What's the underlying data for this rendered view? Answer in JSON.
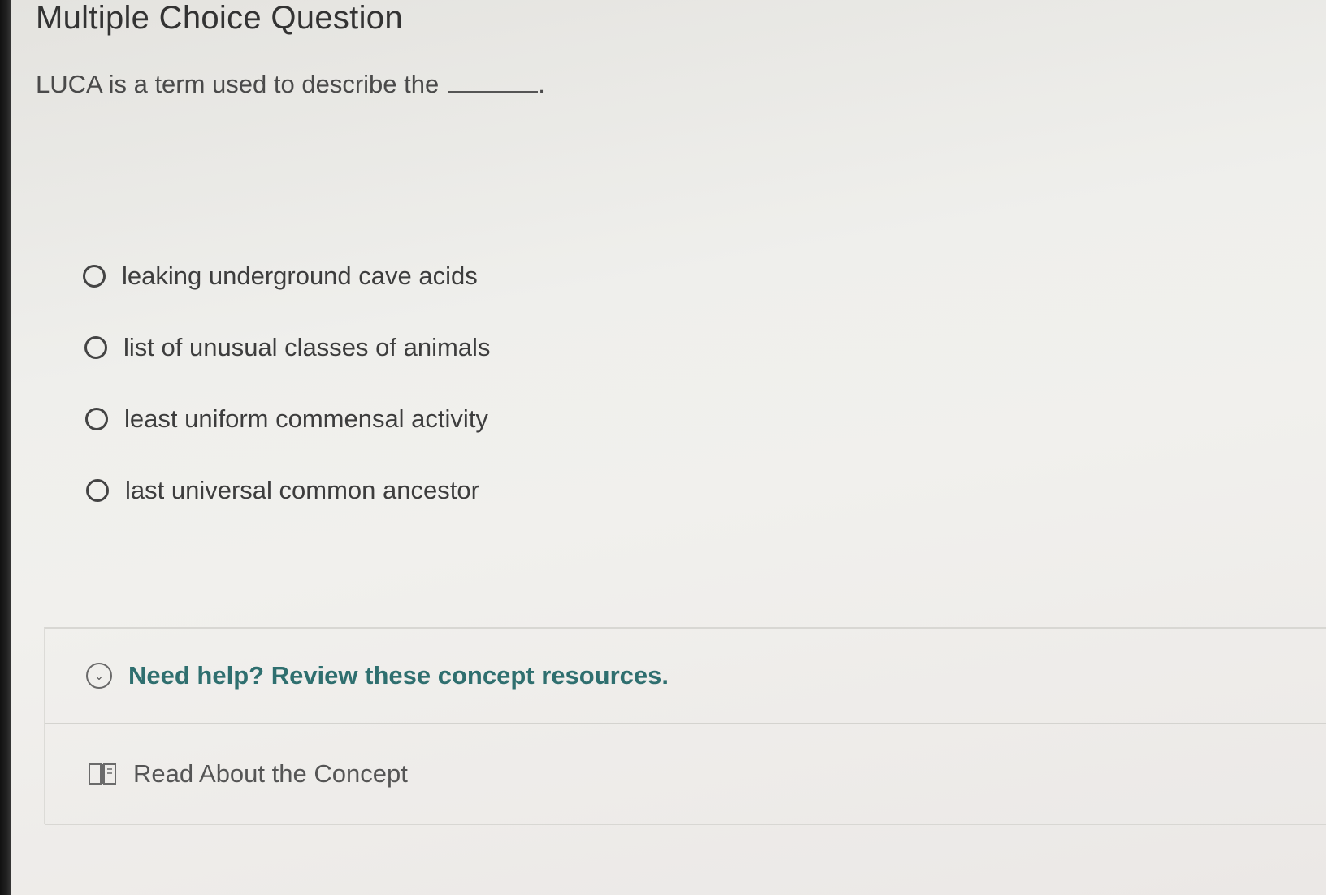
{
  "question": {
    "header": "Multiple Choice Question",
    "prompt": "LUCA is a term used to describe the",
    "blank_suffix": "."
  },
  "options": [
    {
      "label": "leaking underground cave acids"
    },
    {
      "label": "list of unusual classes of animals"
    },
    {
      "label": "least uniform commensal activity"
    },
    {
      "label": "last universal common ancestor"
    }
  ],
  "help": {
    "title": "Need help? Review these concept resources.",
    "icon": "chevron-down-circle-icon",
    "resources": [
      {
        "label": "Read About the Concept",
        "icon": "book-icon"
      }
    ]
  },
  "colors": {
    "help_title": "#2f6f6f",
    "background": "#efefec"
  }
}
